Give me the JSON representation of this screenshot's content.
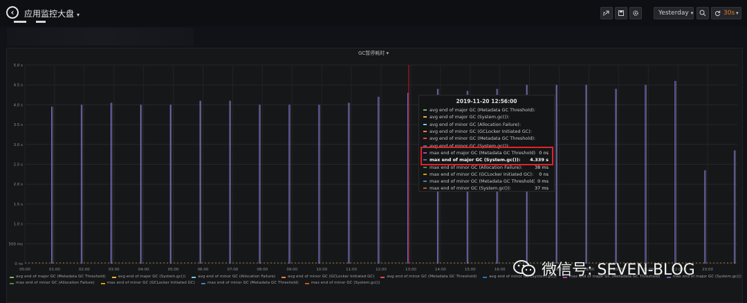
{
  "header": {
    "title": "应用监控大盘",
    "time_picker_label": "Yesterday",
    "refresh_label": "30s"
  },
  "panel": {
    "title": "GC暂停耗时 ▾"
  },
  "icons": {
    "back": "arrow-left-circle-icon",
    "share": "share-icon",
    "save": "save-icon",
    "settings": "gear-icon",
    "clock": "clock-icon",
    "zoom": "zoom-out-icon",
    "refresh": "refresh-icon",
    "watermark": "wechat-icon"
  },
  "chart_data": {
    "type": "line",
    "y_ticks": [
      "5.0 s",
      "4.5 s",
      "4.0 s",
      "3.5 s",
      "3.0 s",
      "2.5 s",
      "2.0 s",
      "1.5 s",
      "1.0 s",
      "500 ms",
      "0 ns"
    ],
    "ylim_seconds": [
      0,
      5
    ],
    "x_ticks": [
      "00:00",
      "01:00",
      "02:00",
      "03:00",
      "04:00",
      "05:00",
      "06:00",
      "07:00",
      "08:00",
      "09:00",
      "10:00",
      "11:00",
      "12:00",
      "13:00",
      "14:00",
      "15:00",
      "16:00",
      "17:00",
      "18:00",
      "19:00",
      "20:00",
      "21:00",
      "22:00",
      "23:00"
    ],
    "x_range_hours": [
      0,
      24
    ],
    "grid": true,
    "spike_series": {
      "name": "max end of major GC (System.gc())",
      "color": "#7b6fd4",
      "points": [
        {
          "hour": 0.9,
          "value": 3.95
        },
        {
          "hour": 1.9,
          "value": 4.0
        },
        {
          "hour": 2.9,
          "value": 4.05
        },
        {
          "hour": 3.9,
          "value": 4.0
        },
        {
          "hour": 4.9,
          "value": 4.0
        },
        {
          "hour": 5.9,
          "value": 4.1
        },
        {
          "hour": 6.9,
          "value": 4.1
        },
        {
          "hour": 7.9,
          "value": 4.0
        },
        {
          "hour": 8.9,
          "value": 4.0
        },
        {
          "hour": 9.9,
          "value": 4.0
        },
        {
          "hour": 10.9,
          "value": 4.05
        },
        {
          "hour": 11.9,
          "value": 4.2
        },
        {
          "hour": 12.9,
          "value": 4.3
        },
        {
          "hour": 13.9,
          "value": 4.4
        },
        {
          "hour": 14.9,
          "value": 4.35
        },
        {
          "hour": 15.9,
          "value": 4.4
        },
        {
          "hour": 16.9,
          "value": 4.5
        },
        {
          "hour": 17.9,
          "value": 4.5
        },
        {
          "hour": 18.9,
          "value": 4.5
        },
        {
          "hour": 19.9,
          "value": 4.4
        },
        {
          "hour": 20.9,
          "value": 4.5
        },
        {
          "hour": 21.9,
          "value": 4.6
        },
        {
          "hour": 22.9,
          "value": 2.35
        },
        {
          "hour": 23.9,
          "value": 2.85
        }
      ]
    },
    "crosshair_hour": 12.93,
    "tooltip": {
      "time": "2019-11-20 12:56:00",
      "rows": [
        {
          "label": "avg end of major GC (Metadata GC Threshold):",
          "value": "",
          "color": "#7eb26d"
        },
        {
          "label": "avg end of major GC (System.gc()):",
          "value": "",
          "color": "#eab839"
        },
        {
          "label": "avg end of minor GC (Allocation Failure):",
          "value": "",
          "color": "#6ed0e0"
        },
        {
          "label": "avg end of minor GC (GCLocker Initiated GC):",
          "value": "",
          "color": "#ef843c"
        },
        {
          "label": "avg end of minor GC (Metadata GC Threshold):",
          "value": "",
          "color": "#e24d42"
        },
        {
          "label": "avg end of minor GC (System.gc()):",
          "value": "",
          "color": "#1f78c1"
        },
        {
          "label": "max end of major GC (Metadata GC Threshold):",
          "value": "0 ns",
          "color": "#ba43a9"
        },
        {
          "label": "max end of major GC (System.gc()):",
          "value": "4.339 s",
          "color": "#705da0",
          "bold": true
        },
        {
          "label": "max end of minor GC (Allocation Failure):",
          "value": "38 ms",
          "color": "#508642"
        },
        {
          "label": "max end of minor GC (GCLocker Initiated GC):",
          "value": "0 ns",
          "color": "#cca300"
        },
        {
          "label": "max end of minor GC (Metadata GC Threshold):",
          "value": "0 ms",
          "color": "#447ebc"
        },
        {
          "label": "max end of minor GC (System.gc()):",
          "value": "37 ms",
          "color": "#c15c17"
        }
      ]
    },
    "legend_rows": [
      [
        {
          "label": "avg end of major GC (Metadata GC Threshold)",
          "color": "#7eb26d"
        },
        {
          "label": "avg end of major GC (System.gc())",
          "color": "#eab839"
        },
        {
          "label": "avg end of minor GC (Allocation Failure)",
          "color": "#6ed0e0"
        },
        {
          "label": "avg end of minor GC (GCLocker Initiated GC)",
          "color": "#ef843c"
        },
        {
          "label": "avg end of minor GC (Metadata GC Threshold)",
          "color": "#e24d42"
        },
        {
          "label": "avg end of minor GC (System.gc())",
          "color": "#1f78c1"
        },
        {
          "label": "max end of major GC (Metadata GC Threshold)",
          "color": "#ba43a9"
        },
        {
          "label": "max end of major GC (System.gc())",
          "color": "#705da0"
        }
      ],
      [
        {
          "label": "max end of minor GC (Allocation Failure)",
          "color": "#508642"
        },
        {
          "label": "max end of minor GC (GCLocker Initiated GC)",
          "color": "#cca300"
        },
        {
          "label": "max end of minor GC (Metadata GC Threshold)",
          "color": "#447ebc"
        },
        {
          "label": "max end of minor GC (System.gc())",
          "color": "#c15c17"
        }
      ]
    ]
  },
  "watermark": {
    "text": "微信号: SEVEN-BLOG"
  }
}
